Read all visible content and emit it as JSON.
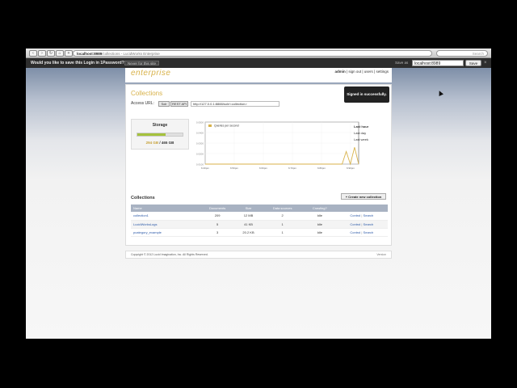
{
  "browser": {
    "url_host": "localhost:8989",
    "url_rest": "/collections - LucidWorks Enterprise",
    "search_placeholder": "Search"
  },
  "onepassword": {
    "question": "Would you like to save this Login in 1Password?",
    "never_label": "Never for this site",
    "save_as_label": "Save as",
    "save_as_value": "localhost:8989",
    "save_button": "Save",
    "close": "×"
  },
  "header": {
    "logo": "enterprise",
    "user": "admin",
    "links": " | sign out | users | settings"
  },
  "main": {
    "title": "Collections",
    "access_label": "Access URL:",
    "solr_label": "Solr",
    "rest_label": "REST API",
    "access_url": "http://127.0.0.1:8888/solr/<collection>",
    "toast": "Signed in successfully."
  },
  "storage": {
    "label": "Storage",
    "used": "294 GB",
    "separator": "/",
    "total": "465 GB",
    "used_fraction": 0.63
  },
  "chart_data": {
    "type": "line",
    "legend": "Queries per second",
    "x": [
      "6:40pm",
      "6:50pm",
      "6:60pm",
      "6:70pm",
      "6:80pm",
      "6:90pm"
    ],
    "y_ticks": [
      "0.0500",
      "0.0400",
      "0.0300",
      "0.0200",
      "0.0100"
    ],
    "series": [
      {
        "name": "Queries per second",
        "values": [
          0,
          0,
          0,
          0,
          0,
          0,
          0,
          0,
          0,
          0,
          0,
          0,
          0,
          0,
          0,
          0,
          0,
          0,
          0,
          0,
          0,
          0,
          0,
          0,
          0,
          0,
          0,
          0,
          0,
          0,
          0,
          0,
          0,
          0,
          0.015,
          0,
          0.02,
          0
        ]
      }
    ],
    "color": "#d8b24a"
  },
  "range_links": {
    "hour": "Last hour",
    "day": "Last day",
    "week": "Last week"
  },
  "collections": {
    "title": "Collections",
    "new_button": "+ Create new collection",
    "columns": [
      "Name",
      "Documents",
      "Size",
      "Data sources",
      "Crawling?",
      ""
    ],
    "rows": [
      {
        "name": "collection1",
        "documents": "209",
        "size": "12 MB",
        "sources": "2",
        "crawling": "Idle",
        "control": "Control",
        "search": "Search"
      },
      {
        "name": "LucidWorksLogs",
        "documents": "5",
        "size": "41 KB",
        "sources": "1",
        "crawling": "Idle",
        "control": "Control",
        "search": "Search"
      },
      {
        "name": "pcategory_example",
        "documents": "3",
        "size": "20.2 KB",
        "sources": "1",
        "crawling": "Idle",
        "control": "Control",
        "search": "Search"
      }
    ],
    "action_sep": "|"
  },
  "footer": {
    "copyright": "Copyright © 2012 Lucid Imagination, Inc. All Rights Reserved.",
    "version": "Version"
  }
}
